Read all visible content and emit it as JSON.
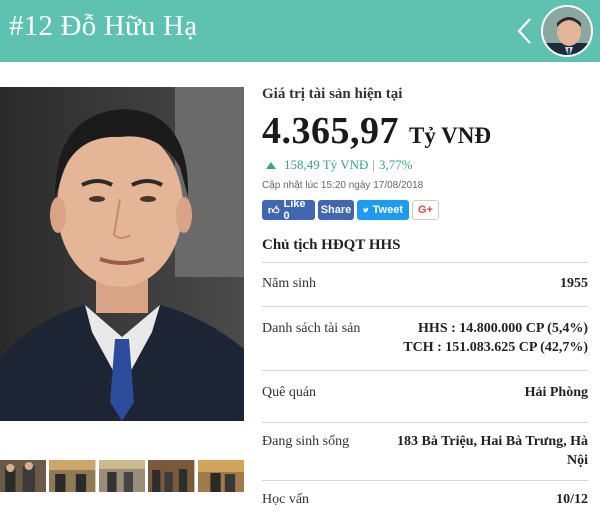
{
  "header": {
    "title": "#12 Đỗ Hữu Hạ"
  },
  "asset": {
    "label": "Giá trị tài sản hiện tại",
    "value": "4.365,97",
    "unit": "Tỷ VNĐ",
    "change_amount": "158,49 Tỷ VNĐ",
    "change_separator": "|",
    "change_percent": "3,77%",
    "updated": "Cập nhật lúc 15:20 ngày 17/08/2018"
  },
  "social": {
    "like_label": "Like 0",
    "share_label": "Share",
    "tweet_label": "Tweet",
    "gplus_label": "G+"
  },
  "position_title": "Chủ tịch HĐQT HHS",
  "details": [
    {
      "label": "Năm sinh",
      "value": "1955"
    },
    {
      "label": "Danh sách tài sản",
      "value_lines": [
        "HHS : 14.800.000 CP (5,4%)",
        "TCH : 151.083.625 CP (42,7%)"
      ]
    },
    {
      "label": "Quê quán",
      "value": "Hải Phòng"
    },
    {
      "label": "Đang sinh sống",
      "value_lines": [
        "183 Bà Triệu, Hai Bà Trưng, Hà",
        "Nội"
      ]
    },
    {
      "label": "Học vấn",
      "value": "10/12"
    }
  ],
  "colors": {
    "header_bg": "#5fc1b0",
    "change_green": "#35a48a",
    "facebook": "#4267b2",
    "twitter": "#1d9bf0"
  }
}
